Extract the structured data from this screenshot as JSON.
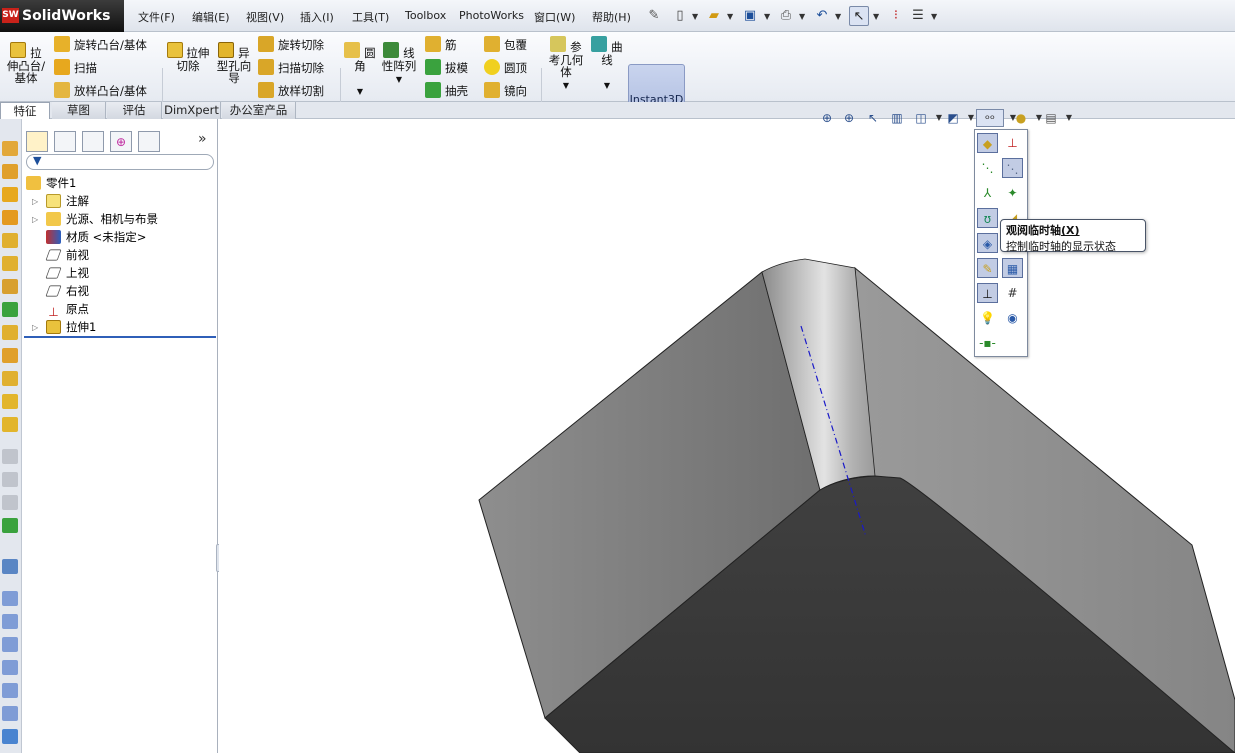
{
  "app": {
    "name": "SolidWorks",
    "badge": "SW"
  },
  "menu": [
    "文件(F)",
    "编辑(E)",
    "视图(V)",
    "插入(I)",
    "工具(T)",
    "Toolbox",
    "PhotoWorks",
    "窗口(W)",
    "帮助(H)"
  ],
  "ribbon": {
    "extrude_boss": "拉伸凸台/基体",
    "revolve_boss": "旋转凸台/基体",
    "sweep": "扫描",
    "loft_boss": "放样凸台/基体",
    "extrude_cut": "拉伸切除",
    "hole_wizard": "异型孔向导",
    "revolve_cut": "旋转切除",
    "sweep_cut": "扫描切除",
    "loft_cut": "放样切割",
    "fillet": "圆角",
    "linear_pattern": "线性阵列",
    "rib": "筋",
    "draft": "拔模",
    "shell": "抽壳",
    "wrap": "包覆",
    "dome": "圆顶",
    "mirror": "镜向",
    "ref_geometry": "参考几何体",
    "curves": "曲线",
    "instant3d": "Instant3D"
  },
  "tabs": [
    "特征",
    "草图",
    "评估",
    "DimXpert",
    "办公室产品"
  ],
  "tree": {
    "root": "零件1",
    "items": [
      "注解",
      "光源、相机与布景",
      "材质 <未指定>",
      "前视",
      "上视",
      "右视",
      "原点",
      "拉伸1"
    ]
  },
  "tooltip": {
    "title": "观阅临时轴",
    "shortcut": "(X)",
    "desc": "控制临时轴的显示状态"
  },
  "colors": {
    "accent": "#1d4f9a",
    "selection": "#c2cce4",
    "model_light": "#a8a8a8",
    "model_dark": "#3a3a3a"
  }
}
